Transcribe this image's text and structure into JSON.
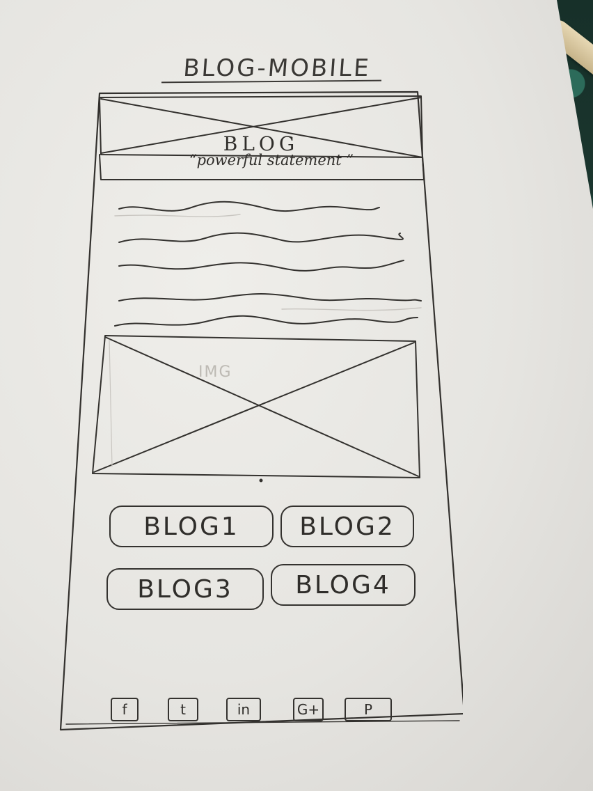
{
  "sketch": {
    "title": "BLOG-MOBILE"
  },
  "header": {
    "title": "BLOG",
    "tagline": "“powerful statement ”"
  },
  "content": {
    "image_label": "IMG"
  },
  "blog_links": [
    {
      "label": "BLOG1"
    },
    {
      "label": "BLOG2"
    },
    {
      "label": "BLOG3"
    },
    {
      "label": "BLOG4"
    }
  ],
  "social_icons": [
    {
      "icon": "facebook-icon",
      "glyph": "f"
    },
    {
      "icon": "twitter-icon",
      "glyph": "t"
    },
    {
      "icon": "linkedin-icon",
      "glyph": "in"
    },
    {
      "icon": "google-plus-icon",
      "glyph": "G+"
    },
    {
      "icon": "pinterest-icon",
      "glyph": "P"
    }
  ]
}
